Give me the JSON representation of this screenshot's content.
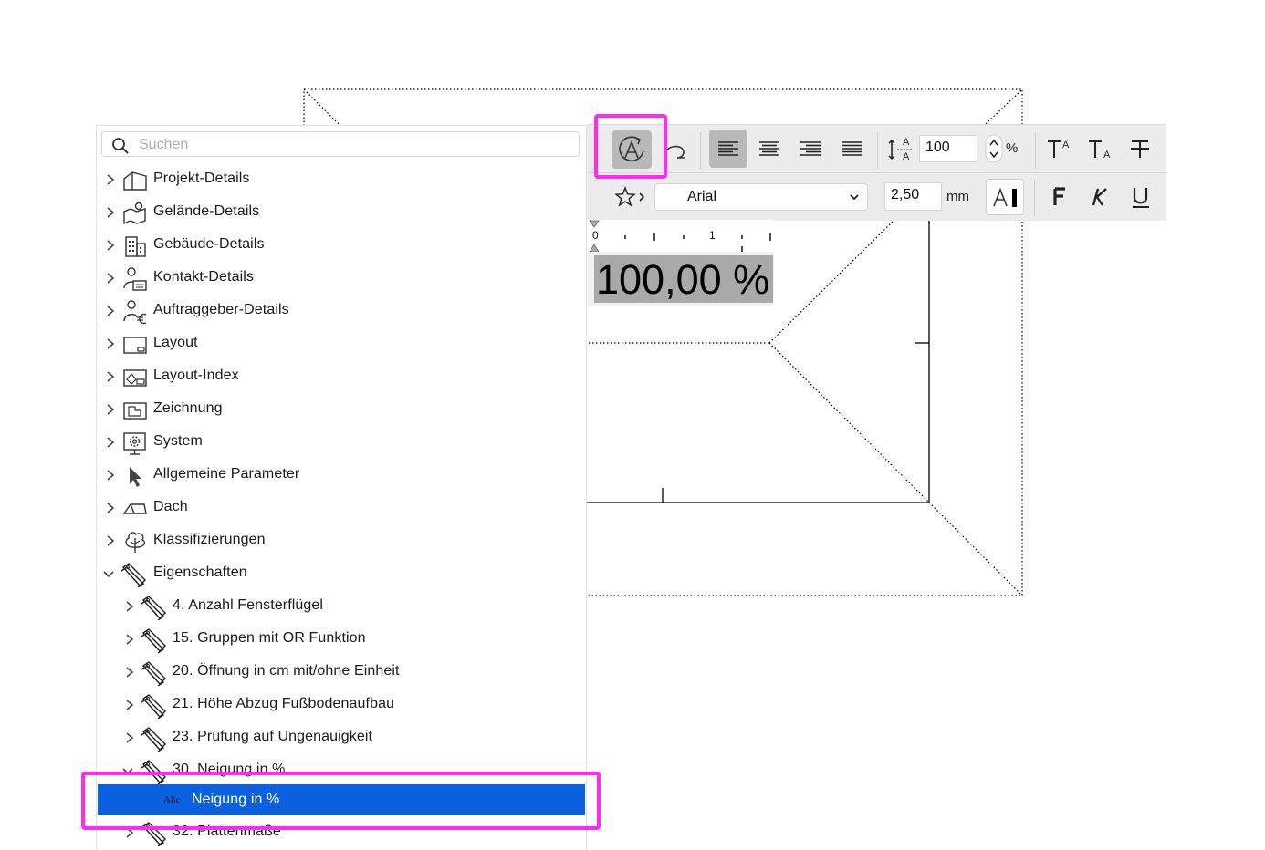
{
  "search": {
    "placeholder": "Suchen"
  },
  "tree": {
    "items": [
      {
        "label": "Projekt-Details",
        "icon": "house-icon"
      },
      {
        "label": "Gelände-Details",
        "icon": "map-pin-icon"
      },
      {
        "label": "Gebäude-Details",
        "icon": "building-icon"
      },
      {
        "label": "Kontakt-Details",
        "icon": "contact-card-icon"
      },
      {
        "label": "Auftraggeber-Details",
        "icon": "client-euro-icon"
      },
      {
        "label": "Layout",
        "icon": "layout-icon"
      },
      {
        "label": "Layout-Index",
        "icon": "layout-index-icon"
      },
      {
        "label": "Zeichnung",
        "icon": "drawing-icon"
      },
      {
        "label": "System",
        "icon": "system-gear-icon"
      },
      {
        "label": "Allgemeine Parameter",
        "icon": "cursor-arrow-icon"
      },
      {
        "label": "Dach",
        "icon": "roof-icon"
      },
      {
        "label": "Klassifizierungen",
        "icon": "tree-classification-icon"
      },
      {
        "label": "Eigenschaften",
        "icon": "tags-icon",
        "expanded": true
      }
    ],
    "children": [
      {
        "label": "4. Anzahl Fensterflügel"
      },
      {
        "label": "15. Gruppen mit OR Funktion"
      },
      {
        "label": "20. Öffnung in cm mit/ohne Einheit"
      },
      {
        "label": "21. Höhe Abzug Fußbodenaufbau"
      },
      {
        "label": "23. Prüfung auf Ungenauigkeit"
      },
      {
        "label": "30. Neigung in %",
        "expanded": true
      },
      {
        "label": "32. Plattenmaße"
      }
    ],
    "selected": {
      "label": "Neigung in %",
      "type_badge": "Abc"
    }
  },
  "toolbar": {
    "line_spacing_value": "100",
    "line_spacing_unit": "%",
    "font_name": "Arial",
    "font_size_value": "2,50",
    "font_size_unit": "mm",
    "ruler_label_0": "0",
    "ruler_label_1": "1"
  },
  "canvas": {
    "text_value": "100,00 %"
  },
  "colors": {
    "selection": "#0a60df",
    "highlight": "#ff2bf0",
    "toolbar_bg": "#ececec"
  }
}
